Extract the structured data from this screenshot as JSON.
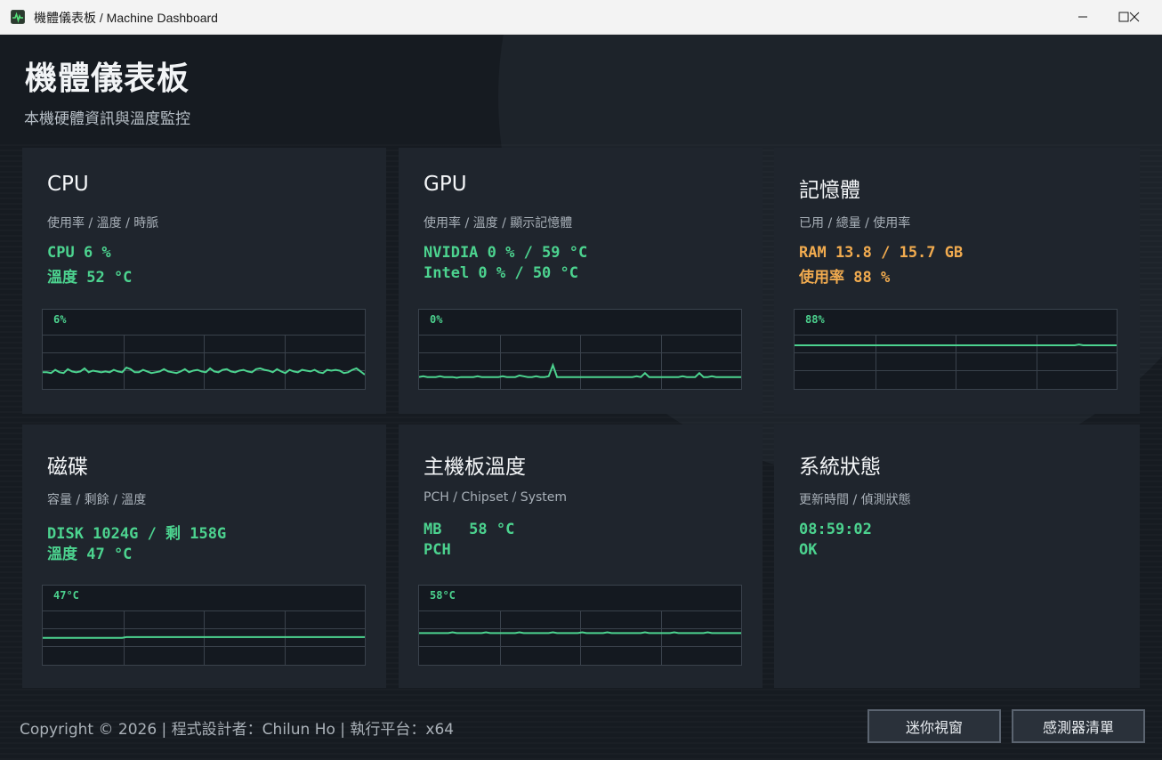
{
  "window": {
    "title": "機體儀表板 / Machine Dashboard",
    "icon": "pulse-monitor-icon",
    "controls": [
      "minimize-icon",
      "maximize-icon",
      "close-icon"
    ]
  },
  "header": {
    "title": "機體儀表板",
    "subtitle": "本機硬體資訊與溫度監控"
  },
  "cards": {
    "cpu": {
      "title": "CPU",
      "subtitle": "使用率 / 溫度 / 時脈",
      "line1": "CPU 6 %",
      "line2": "溫度 52 °C",
      "graph_label": "6%",
      "graph_values": [
        21,
        21,
        20,
        24,
        21,
        20,
        25,
        22,
        21,
        22,
        26,
        21,
        23,
        22,
        21,
        22,
        21,
        24,
        22,
        21,
        27,
        25,
        21,
        21,
        24,
        22,
        20,
        21,
        22,
        25,
        22,
        21,
        20,
        22,
        25,
        21,
        23,
        24,
        22,
        21,
        26,
        22,
        21,
        24,
        25,
        22,
        21,
        23,
        24,
        22,
        21,
        25,
        26,
        24,
        23,
        21,
        25,
        22,
        20,
        24,
        22,
        21,
        24,
        23,
        22,
        24,
        21,
        20,
        24,
        23,
        24,
        23,
        20,
        21,
        24,
        26,
        22,
        18
      ],
      "graph_max": 100
    },
    "gpu": {
      "title": "GPU",
      "subtitle": "使用率 / 溫度 / 顯示記憶體",
      "line1": "NVIDIA 0 % / 59 °C",
      "line2": "Intel 0 % / 50 °C",
      "graph_label": "0%",
      "graph_values": [
        15,
        16,
        15,
        15,
        15,
        16,
        15,
        15,
        15,
        14,
        15,
        15,
        15,
        15,
        16,
        15,
        15,
        15,
        15,
        15,
        16,
        15,
        15,
        15,
        17,
        16,
        15,
        15,
        16,
        15,
        15,
        16,
        30,
        15,
        15,
        15,
        15,
        15,
        15,
        15,
        15,
        15,
        15,
        15,
        15,
        15,
        15,
        15,
        15,
        15,
        15,
        15,
        16,
        15,
        20,
        15,
        15,
        15,
        15,
        15,
        15,
        15,
        15,
        16,
        15,
        15,
        15,
        20,
        15,
        15,
        16,
        15,
        15,
        15,
        15,
        15,
        15,
        15
      ],
      "graph_max": 100
    },
    "memory": {
      "title": "記憶體",
      "subtitle": "已用 / 總量 / 使用率",
      "line1": "RAM 13.8 / 15.7 GB",
      "line2": "使用率 88 %",
      "graph_label": "88%",
      "graph_values": [
        55,
        55,
        55,
        55,
        55,
        55,
        55,
        55,
        55,
        55,
        55,
        55,
        55,
        55,
        55,
        55,
        55,
        55,
        55,
        55,
        55,
        55,
        55,
        55,
        55,
        55,
        55,
        55,
        55,
        55,
        55,
        55,
        55,
        55,
        55,
        55,
        55,
        55,
        55,
        55,
        55,
        55,
        55,
        55,
        55,
        55,
        55,
        55,
        55,
        55,
        55,
        55,
        55,
        55,
        55,
        55,
        55,
        55,
        55,
        55,
        55,
        55,
        55,
        55,
        55,
        55,
        55,
        55,
        56,
        55,
        55,
        55,
        55,
        55,
        55,
        55,
        55,
        55
      ],
      "graph_max": 100
    },
    "disk": {
      "title": "磁碟",
      "subtitle": "容量 / 剩餘 / 溫度",
      "line1": "DISK 1024G / 剩 158G",
      "line2": "溫度 47 °C",
      "graph_label": "47°C",
      "graph_values": [
        34,
        34,
        34,
        34,
        34,
        34,
        34,
        34,
        34,
        34,
        34,
        34,
        34,
        34,
        34,
        34,
        34,
        34,
        34,
        34,
        35,
        35,
        35,
        35,
        35,
        35,
        35,
        35,
        35,
        35,
        35,
        35,
        35,
        35,
        35,
        35,
        35,
        35,
        35,
        35,
        35,
        35,
        35,
        35,
        35,
        35,
        35,
        35,
        35,
        35,
        35,
        35,
        35,
        35,
        35,
        35,
        35,
        35,
        35,
        35,
        35,
        35,
        35,
        35,
        35,
        35,
        35,
        35,
        35,
        35,
        35,
        35,
        35,
        35,
        35,
        35,
        35,
        35
      ],
      "graph_max": 100
    },
    "motherboard": {
      "title": "主機板溫度",
      "subtitle": "PCH / Chipset / System",
      "line1": "MB   58 °C",
      "line2": "PCH",
      "graph_label": "58°C",
      "graph_values": [
        40,
        40,
        40,
        40,
        40,
        40,
        40,
        40,
        41,
        40,
        40,
        40,
        40,
        40,
        40,
        40,
        41,
        40,
        40,
        40,
        40,
        40,
        40,
        40,
        41,
        40,
        40,
        40,
        40,
        40,
        40,
        40,
        41,
        40,
        40,
        40,
        40,
        40,
        40,
        41,
        40,
        40,
        40,
        40,
        40,
        41,
        40,
        40,
        40,
        40,
        40,
        40,
        40,
        40,
        41,
        40,
        40,
        40,
        40,
        40,
        40,
        41,
        40,
        40,
        40,
        40,
        40,
        40,
        40,
        41,
        40,
        40,
        40,
        40,
        40,
        40,
        40,
        40
      ],
      "graph_max": 100
    },
    "status": {
      "title": "系統狀態",
      "subtitle": "更新時間 / 偵測狀態",
      "line1": "08:59:02",
      "line2": "OK"
    }
  },
  "footer": {
    "copyright": "Copyright © 2026 | 程式設計者：Chilun Ho | 執行平台：x64",
    "mini_view_button": "迷你視窗",
    "sensor_list_button": "感測器清單"
  },
  "colors": {
    "accent_green": "#4cd38f",
    "accent_orange": "#f1ab4f"
  }
}
